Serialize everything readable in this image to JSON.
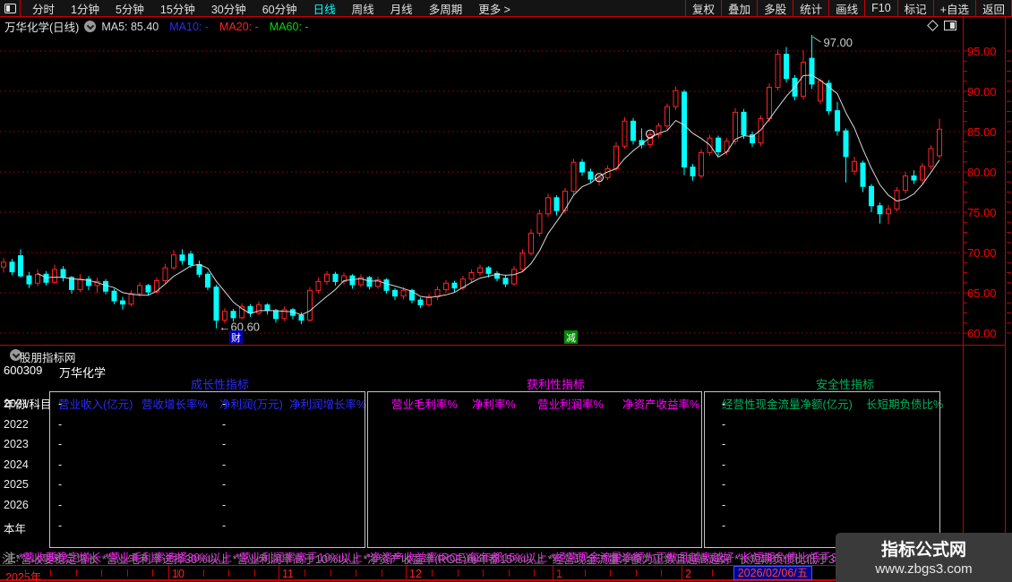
{
  "toolbar": {
    "periods": [
      "分时",
      "1分钟",
      "5分钟",
      "15分钟",
      "30分钟",
      "60分钟",
      "日线",
      "周线",
      "月线",
      "多周期",
      "更多 >"
    ],
    "active_period": "日线",
    "actions": [
      "复权",
      "叠加",
      "多股",
      "统计",
      "画线",
      "F10",
      "标记",
      "+自选",
      "返回"
    ]
  },
  "ma_row": {
    "title": "万华化学(日线)",
    "ma_items": [
      {
        "label": "MA5: 85.40",
        "color": "#dcdcdc"
      },
      {
        "label": "MA10: -",
        "color": "#2a2aff"
      },
      {
        "label": "MA20: -",
        "color": "#ff2222"
      },
      {
        "label": "MA60: -",
        "color": "#00dd00"
      }
    ]
  },
  "chart_data": {
    "type": "candlestick",
    "title": "万华化学(日线)",
    "code": "600309",
    "up_color": "#ff2222",
    "down_color": "#00ffff",
    "grid_color": "#b40000",
    "ylim": [
      58.6,
      97.6
    ],
    "y_ticks": [
      95,
      90,
      85,
      80,
      75,
      70,
      65,
      60
    ],
    "y_tick_labels": [
      "95.00",
      "90.00",
      "85.00",
      "80.00",
      "75.00",
      "70.00",
      "65.00",
      "60.00"
    ],
    "annotations": [
      {
        "text": "97.00",
        "x_index": 95,
        "price": 97.0,
        "kind": "peak-callout"
      },
      {
        "text": "←60.60",
        "x_index": 25,
        "price": 60.6,
        "kind": "low-callout"
      }
    ],
    "event_markers": [
      {
        "text": "财",
        "bg": "#0000bb",
        "x": 256
      },
      {
        "text": "减",
        "bg": "#008800",
        "x": 630
      }
    ],
    "circle_markers": [
      {
        "x_index": 70,
        "price": 79.3
      },
      {
        "x_index": 76,
        "price": 84.7
      }
    ],
    "candles": [
      [
        68.2,
        69.3,
        67.5,
        68.8
      ],
      [
        68.8,
        69.2,
        67.2,
        67.6
      ],
      [
        69.6,
        70.4,
        66.9,
        67.1
      ],
      [
        67.1,
        67.6,
        65.6,
        66.1
      ],
      [
        66.2,
        67.9,
        65.8,
        67.3
      ],
      [
        67.3,
        67.7,
        65.9,
        66.3
      ],
      [
        66.3,
        68.5,
        66.1,
        67.9
      ],
      [
        67.9,
        68.3,
        66.4,
        66.9
      ],
      [
        66.9,
        67.1,
        64.9,
        65.4
      ],
      [
        65.4,
        67.3,
        65.1,
        66.7
      ],
      [
        66.7,
        67.1,
        65.3,
        65.9
      ],
      [
        65.9,
        66.9,
        65.0,
        66.4
      ],
      [
        66.4,
        66.7,
        64.8,
        65.2
      ],
      [
        65.2,
        65.5,
        63.6,
        64.0
      ],
      [
        64.0,
        64.5,
        62.9,
        63.6
      ],
      [
        63.6,
        65.3,
        63.3,
        64.9
      ],
      [
        64.9,
        66.3,
        64.5,
        65.9
      ],
      [
        65.9,
        66.1,
        64.7,
        65.1
      ],
      [
        65.1,
        66.9,
        64.9,
        66.5
      ],
      [
        66.5,
        68.6,
        66.2,
        68.1
      ],
      [
        68.1,
        70.3,
        67.8,
        69.7
      ],
      [
        69.7,
        70.4,
        68.5,
        69.0
      ],
      [
        69.8,
        70.2,
        68.1,
        68.5
      ],
      [
        68.5,
        69.0,
        66.9,
        67.3
      ],
      [
        67.3,
        67.6,
        65.3,
        65.7
      ],
      [
        65.7,
        66.0,
        60.6,
        61.6
      ],
      [
        61.6,
        63.1,
        61.2,
        62.7
      ],
      [
        62.7,
        63.0,
        61.4,
        61.9
      ],
      [
        61.9,
        63.7,
        61.7,
        63.3
      ],
      [
        63.3,
        63.6,
        62.0,
        62.5
      ],
      [
        62.5,
        63.9,
        62.2,
        63.5
      ],
      [
        63.5,
        63.7,
        62.3,
        62.8
      ],
      [
        62.8,
        63.0,
        61.3,
        61.8
      ],
      [
        61.8,
        63.3,
        61.5,
        62.9
      ],
      [
        62.9,
        63.1,
        61.7,
        62.2
      ],
      [
        62.2,
        62.6,
        61.1,
        61.6
      ],
      [
        61.6,
        65.7,
        61.4,
        65.3
      ],
      [
        65.3,
        66.9,
        64.9,
        66.4
      ],
      [
        66.4,
        67.7,
        66.0,
        67.3
      ],
      [
        67.3,
        67.6,
        65.9,
        66.4
      ],
      [
        66.4,
        67.5,
        66.0,
        67.1
      ],
      [
        67.1,
        67.3,
        65.5,
        66.0
      ],
      [
        66.0,
        67.3,
        65.7,
        66.9
      ],
      [
        66.9,
        67.1,
        65.4,
        65.8
      ],
      [
        65.8,
        67.0,
        65.5,
        66.6
      ],
      [
        66.6,
        66.8,
        64.9,
        65.3
      ],
      [
        65.3,
        65.6,
        64.1,
        64.6
      ],
      [
        64.6,
        65.7,
        64.2,
        65.3
      ],
      [
        65.3,
        65.5,
        63.7,
        64.1
      ],
      [
        64.1,
        64.4,
        63.1,
        63.5
      ],
      [
        63.5,
        64.9,
        63.3,
        64.5
      ],
      [
        64.5,
        65.8,
        64.1,
        65.4
      ],
      [
        65.4,
        66.6,
        65.0,
        66.2
      ],
      [
        66.2,
        66.5,
        65.1,
        65.6
      ],
      [
        65.6,
        67.1,
        65.3,
        66.7
      ],
      [
        66.7,
        67.9,
        66.3,
        67.5
      ],
      [
        67.5,
        68.5,
        67.1,
        68.1
      ],
      [
        68.1,
        68.3,
        66.9,
        67.4
      ],
      [
        67.4,
        67.7,
        66.4,
        66.8
      ],
      [
        66.8,
        67.2,
        65.7,
        66.1
      ],
      [
        66.1,
        68.3,
        65.9,
        67.9
      ],
      [
        67.9,
        70.4,
        67.6,
        69.9
      ],
      [
        69.9,
        72.9,
        69.6,
        72.4
      ],
      [
        72.4,
        75.3,
        72.0,
        74.8
      ],
      [
        74.8,
        77.3,
        74.4,
        76.8
      ],
      [
        76.8,
        77.1,
        74.6,
        75.2
      ],
      [
        75.2,
        78.0,
        74.8,
        77.6
      ],
      [
        77.6,
        81.6,
        77.2,
        81.2
      ],
      [
        81.2,
        81.6,
        79.5,
        80.0
      ],
      [
        80.0,
        80.4,
        78.7,
        79.1
      ],
      [
        79.1,
        79.6,
        78.3,
        79.3
      ],
      [
        79.3,
        80.8,
        79.0,
        80.4
      ],
      [
        80.4,
        83.7,
        80.1,
        83.2
      ],
      [
        83.2,
        86.8,
        82.9,
        86.3
      ],
      [
        86.3,
        86.7,
        83.4,
        83.9
      ],
      [
        83.9,
        85.4,
        82.9,
        83.4
      ],
      [
        83.4,
        85.0,
        83.0,
        84.6
      ],
      [
        84.6,
        86.1,
        84.2,
        85.7
      ],
      [
        85.7,
        88.5,
        85.3,
        88.1
      ],
      [
        88.1,
        90.6,
        87.7,
        90.1
      ],
      [
        89.9,
        90.2,
        79.6,
        80.6
      ],
      [
        80.6,
        81.0,
        78.9,
        79.5
      ],
      [
        79.5,
        82.8,
        79.2,
        82.4
      ],
      [
        82.4,
        84.6,
        82.0,
        84.2
      ],
      [
        84.2,
        84.5,
        82.0,
        82.5
      ],
      [
        82.5,
        84.2,
        82.1,
        83.8
      ],
      [
        83.8,
        87.9,
        83.4,
        87.4
      ],
      [
        87.4,
        87.8,
        84.1,
        84.6
      ],
      [
        84.6,
        85.0,
        83.1,
        83.6
      ],
      [
        83.6,
        87.0,
        83.2,
        86.6
      ],
      [
        86.6,
        91.0,
        86.2,
        90.5
      ],
      [
        90.5,
        95.2,
        90.1,
        94.6
      ],
      [
        94.6,
        95.5,
        91.1,
        91.6
      ],
      [
        91.6,
        92.0,
        88.9,
        89.4
      ],
      [
        89.4,
        95.1,
        89.0,
        93.6
      ],
      [
        94.1,
        97.0,
        90.3,
        90.9
      ],
      [
        88.8,
        91.6,
        88.4,
        91.3
      ],
      [
        91.0,
        91.4,
        87.1,
        87.6
      ],
      [
        87.6,
        88.7,
        84.5,
        85.1
      ],
      [
        85.1,
        85.4,
        78.7,
        81.9
      ],
      [
        80.1,
        81.9,
        79.6,
        81.3
      ],
      [
        81.1,
        81.4,
        77.5,
        78.2
      ],
      [
        78.2,
        78.5,
        75.0,
        75.8
      ],
      [
        75.8,
        76.2,
        73.6,
        74.8
      ],
      [
        74.8,
        75.9,
        73.5,
        75.4
      ],
      [
        75.4,
        78.1,
        75.1,
        77.7
      ],
      [
        77.7,
        80.0,
        77.3,
        79.5
      ],
      [
        79.5,
        80.2,
        78.5,
        79.0
      ],
      [
        79.0,
        81.1,
        78.6,
        80.7
      ],
      [
        80.7,
        83.3,
        80.3,
        82.9
      ],
      [
        82.0,
        86.6,
        81.7,
        85.3
      ]
    ]
  },
  "panel": {
    "source": "股朋指标网",
    "code": "600309",
    "name": "万华化学",
    "row_header": "年份/科目",
    "growth": {
      "title": "成长性指标",
      "color": "#2a2aff",
      "headers": [
        "营业收入(亿元)",
        "营收增长率%",
        "净利润(万元)",
        "净利润增长率%"
      ]
    },
    "profit": {
      "title": "获利性指标",
      "color": "#ff00ff",
      "headers": [
        "营业毛利率%",
        "净利率%",
        "营业利润率%",
        "净资产收益率%"
      ]
    },
    "safety": {
      "title": "安全性指标",
      "color": "#00b25c",
      "headers": [
        "经营性现金流量净额(亿元)",
        "长短期负债比%"
      ]
    },
    "rows": [
      {
        "label": "2021",
        "values": [
          "-",
          "-",
          "-"
        ]
      },
      {
        "label": "2022",
        "values": [
          "-",
          "-",
          "-"
        ]
      },
      {
        "label": "2023",
        "values": [
          "-",
          "-",
          "-"
        ]
      },
      {
        "label": "2024",
        "values": [
          "-",
          "-",
          "-"
        ]
      },
      {
        "label": "2025",
        "values": [
          "-",
          "-",
          "-"
        ]
      },
      {
        "label": "2026",
        "values": [
          "-",
          "-",
          "-"
        ]
      },
      {
        "label": "本年",
        "values": [
          "-",
          "-",
          "-"
        ]
      }
    ]
  },
  "note": {
    "marker": "注:",
    "text": "*营收要稳定增长 *营业毛利率选择30%以上 *营业利润率高于10%以上 *净资产收益率(ROE)每年都15%以上 *经营现金流量净额为正数且越高越好 *长短期负债比低于30%体制较安全"
  },
  "timeline": {
    "labels": [
      {
        "text": "2025年",
        "x": 6
      },
      {
        "text": "10",
        "x": 192
      },
      {
        "text": "11",
        "x": 315
      },
      {
        "text": "12",
        "x": 457
      },
      {
        "text": "1",
        "x": 621
      },
      {
        "text": "2",
        "x": 765
      }
    ],
    "major_ticks": [
      188,
      311,
      453,
      617,
      761
    ],
    "highlight_date": "2026/02/06/五"
  },
  "watermark": {
    "line1": "指标公式网",
    "line2": "www.zbgs3.com"
  }
}
